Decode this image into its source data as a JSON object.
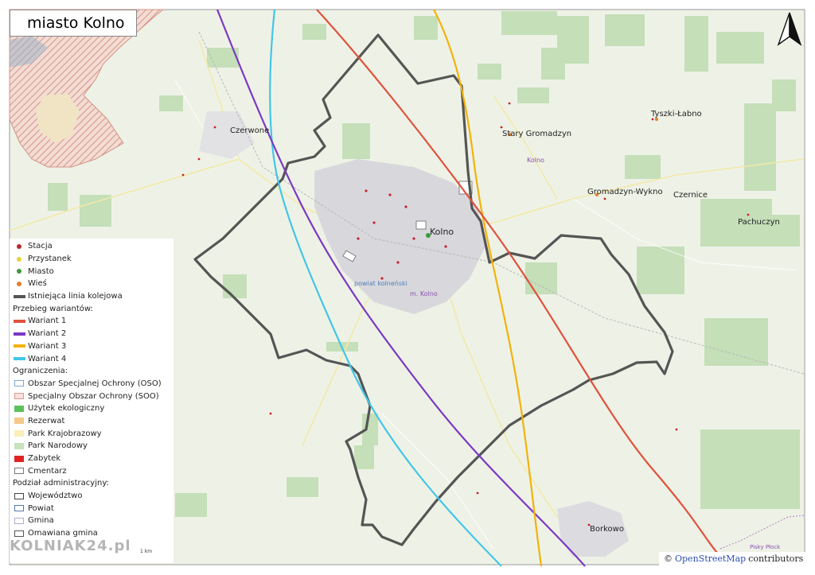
{
  "title": "miasto Kolno",
  "places": {
    "kolno": "Kolno",
    "czerwone": "Czerwone",
    "stary_gromadzyn": "Stary Gromadzyn",
    "kolno_small": "Kolno",
    "tyszki_labno": "Tyszki-Łabno",
    "gromadzyn_wykno": "Gromadzyn-Wykno",
    "czernice": "Czernice",
    "pachuczyn": "Pachuczyn",
    "borkowo": "Borkowo",
    "powiat": "powiat kolneński",
    "miasto_label": "m. Kolno",
    "pisa": "Pisky Płock"
  },
  "legend": {
    "items": [
      {
        "label": "Stacja",
        "kind": "dot",
        "color": "#b5282b"
      },
      {
        "label": "Przystanek",
        "kind": "dot",
        "color": "#e8d43a"
      },
      {
        "label": "Miasto",
        "kind": "dot",
        "color": "#3a9a3a"
      },
      {
        "label": "Wieś",
        "kind": "dot",
        "color": "#e0802a"
      },
      {
        "label": "Istniejąca linia kolejowa",
        "kind": "line",
        "color": "#555555"
      }
    ],
    "variants_heading": "Przebieg wariantów:",
    "variants": [
      {
        "label": "Wariant 1",
        "color": "#e0523e"
      },
      {
        "label": "Wariant 2",
        "color": "#7b38c4"
      },
      {
        "label": "Wariant 3",
        "color": "#f2b20c"
      },
      {
        "label": "Wariant 4",
        "color": "#41c6e8"
      }
    ],
    "restrictions_heading": "Ograniczenia:",
    "restrictions": [
      {
        "label": "Obszar Specjalnej Ochrony (OSO)",
        "fill": "#ffffff",
        "border": "#7aa8d8"
      },
      {
        "label": "Specjalny Obszar Ochrony (SOO)",
        "fill": "#f8e0dc",
        "border": "#d89a90"
      },
      {
        "label": "Użytek ekologiczny",
        "fill": "#5cc25a",
        "border": "#5cc25a"
      },
      {
        "label": "Rezerwat",
        "fill": "#f5c98a",
        "border": "#f5c98a"
      },
      {
        "label": "Park Krajobrazowy",
        "fill": "#fbefb8",
        "border": "#fbefb8"
      },
      {
        "label": "Park Narodowy",
        "fill": "#c7e2bd",
        "border": "#c7e2bd"
      },
      {
        "label": "Zabytek",
        "fill": "#e02222",
        "border": "#e02222"
      },
      {
        "label": "Cmentarz",
        "fill": "#ffffff",
        "border": "#777777"
      }
    ],
    "admin_heading": "Podział administracyjny:",
    "admin": [
      {
        "label": "Województwo",
        "fill": "#ffffff",
        "border": "#444444"
      },
      {
        "label": "Powiat",
        "fill": "#ffffff",
        "border": "#5577aa"
      },
      {
        "label": "Gmina",
        "fill": "#ffffff",
        "border": "#b9a7cf"
      },
      {
        "label": "Omawiana gmina",
        "fill": "#ffffff",
        "border": "#555555"
      }
    ]
  },
  "scale_label": "1 km",
  "attribution": {
    "prefix": "©",
    "link": "OpenStreetMap",
    "suffix": "contributors"
  },
  "watermark": "KOLNIAK24.pl",
  "colors": {
    "background": "#eef2e6",
    "forest": "#c5dfb9",
    "boundary": "#555555",
    "urban": "#d8d8dc"
  },
  "icons": {
    "north_arrow": "north-arrow-icon"
  }
}
